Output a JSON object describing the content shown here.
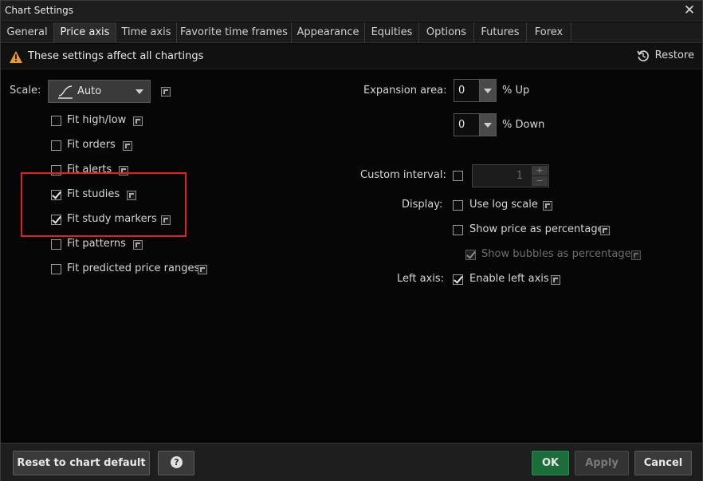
{
  "window": {
    "title": "Chart Settings"
  },
  "tabs": [
    {
      "label": "General"
    },
    {
      "label": "Price axis"
    },
    {
      "label": "Time axis"
    },
    {
      "label": "Favorite time frames"
    },
    {
      "label": "Appearance"
    },
    {
      "label": "Equities"
    },
    {
      "label": "Options"
    },
    {
      "label": "Futures"
    },
    {
      "label": "Forex"
    }
  ],
  "active_tab": "Price axis",
  "notice": {
    "text": "These settings affect all chartings",
    "restore_label": "Restore"
  },
  "left": {
    "scale_label": "Scale:",
    "scale_value": "Auto",
    "fit_options": [
      {
        "label": "Fit high/low",
        "checked": false
      },
      {
        "label": "Fit orders",
        "checked": false
      },
      {
        "label": "Fit alerts",
        "checked": false
      },
      {
        "label": "Fit studies",
        "checked": true
      },
      {
        "label": "Fit study markers",
        "checked": true
      },
      {
        "label": "Fit patterns",
        "checked": false
      },
      {
        "label": "Fit predicted price ranges",
        "checked": false
      }
    ]
  },
  "right": {
    "expansion_label": "Expansion area:",
    "expansion_up_value": "0",
    "expansion_up_unit": "% Up",
    "expansion_down_value": "0",
    "expansion_down_unit": "% Down",
    "custom_interval_label": "Custom interval:",
    "custom_interval_checked": false,
    "custom_interval_value": "1",
    "display_label": "Display:",
    "use_log_scale": {
      "label": "Use log scale",
      "checked": false
    },
    "show_price_pct": {
      "label": "Show price as percentage",
      "checked": false
    },
    "show_bubbles_pct": {
      "label": "Show bubbles as percentage",
      "checked": true,
      "disabled": true
    },
    "left_axis_label": "Left axis:",
    "enable_left_axis": {
      "label": "Enable left axis",
      "checked": true
    }
  },
  "footer": {
    "reset_label": "Reset to chart default",
    "help_glyph": "?",
    "ok_label": "OK",
    "apply_label": "Apply",
    "cancel_label": "Cancel"
  },
  "colors": {
    "ok_green": "#1b6e3a",
    "highlight_red": "#e02020",
    "warning_orange": "#f39c12"
  }
}
